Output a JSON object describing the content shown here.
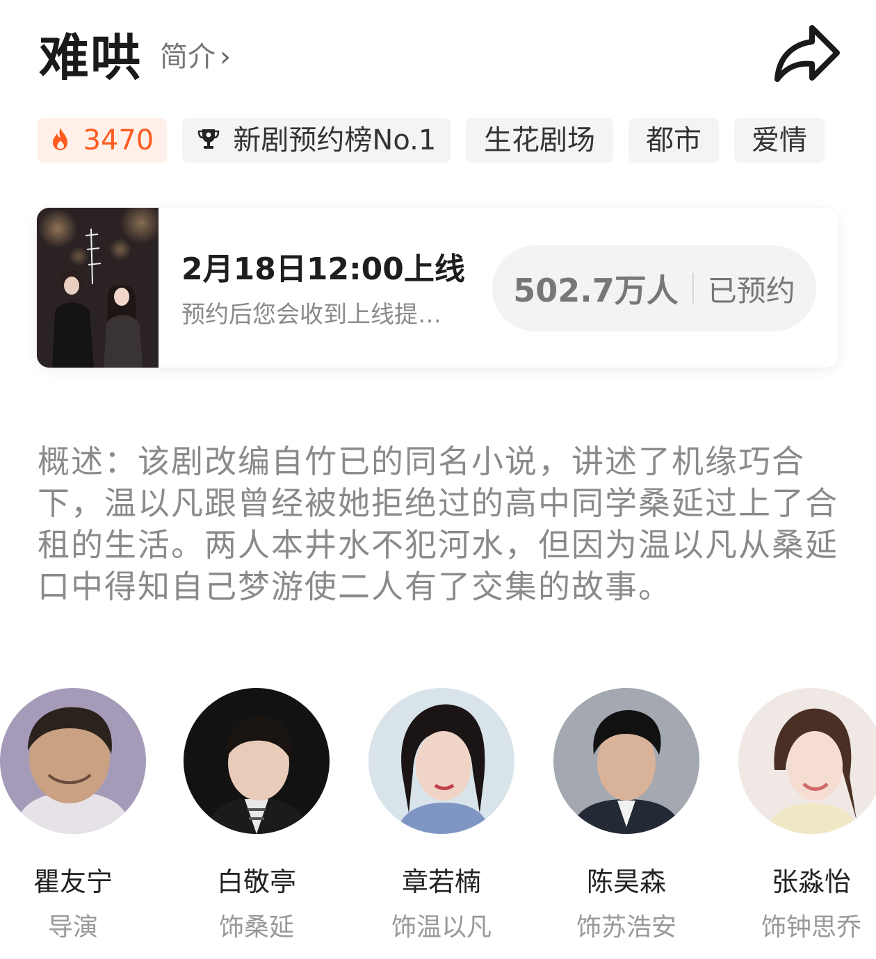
{
  "header": {
    "title": "难哄",
    "intro_label": "简介",
    "share_icon": "share-arrow-icon"
  },
  "tags": [
    {
      "label": "3470",
      "icon": "flame-icon",
      "color": "#ff5a1f"
    },
    {
      "label": "新剧预约榜No.1",
      "icon": "trophy-icon"
    },
    {
      "label": "生花剧场"
    },
    {
      "label": "都市"
    },
    {
      "label": "爱情"
    }
  ],
  "premiere": {
    "date_text": "2月18日12:00上线",
    "subtitle": "预约后您会收到上线提…",
    "reserve_count": "502.7万人",
    "reserve_label": "已预约"
  },
  "synopsis": "概述：该剧改编自竹已的同名小说，讲述了机缘巧合下，温以凡跟曾经被她拒绝过的高中同学桑延过上了合租的生活。两人本井水不犯河水，但因为温以凡从桑延口中得知自己梦游使二人有了交集的故事。",
  "cast": [
    {
      "name": "瞿友宁",
      "role": "导演"
    },
    {
      "name": "白敬亭",
      "role": "饰桑延"
    },
    {
      "name": "章若楠",
      "role": "饰温以凡"
    },
    {
      "name": "陈昊森",
      "role": "饰苏浩安"
    },
    {
      "name": "张淼怡",
      "role": "饰钟思乔"
    }
  ],
  "colors": {
    "accent": "#ff5a1f",
    "tag_bg": "#f4f4f4",
    "hot_tag_bg": "#fff1ea",
    "muted_text": "#8a8a8a"
  }
}
